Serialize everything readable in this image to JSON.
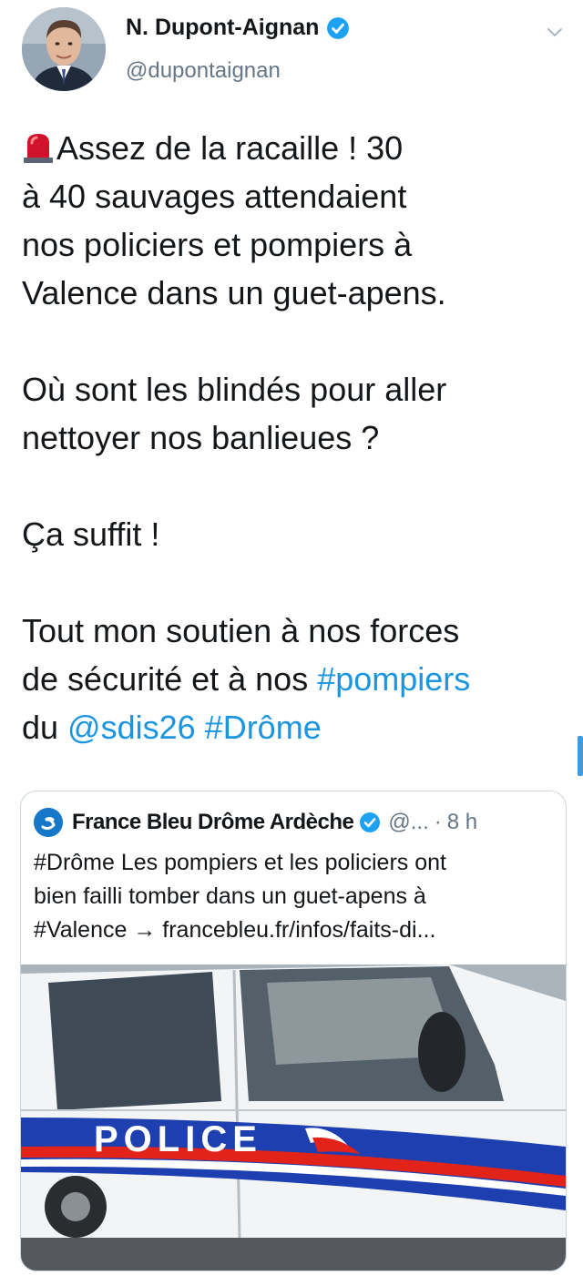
{
  "author": {
    "name": "N. Dupont-Aignan",
    "handle": "@dupontaignan"
  },
  "tweet": {
    "line1": "Assez de la racaille ! 30",
    "line2": "à 40 sauvages attendaient",
    "line3": "nos policiers et pompiers à",
    "line4": "Valence dans un guet-apens.",
    "line5": "Où sont les blindés pour aller",
    "line6": "nettoyer nos banlieues ?",
    "line7": "Ça suffit !",
    "line8": "Tout mon soutien à nos forces",
    "line9_text": "de sécurité et à nos ",
    "line9_hashtag": "#pompiers",
    "line10_text": "du ",
    "line10_mention": "@sdis26",
    "line10_hashtag": "#Drôme"
  },
  "quoted_tweet": {
    "name": "France Bleu Drôme Ardèche",
    "handle": "@...",
    "separator": "·",
    "time": "8 h",
    "line1": "#Drôme Les pompiers et les policiers ont",
    "line2": "bien failli tomber dans un guet-apens à",
    "line3": "#Valence → francebleu.fr/infos/faits-di...",
    "image_text": "POLICE"
  },
  "icons": {
    "verified": "verified-badge-icon",
    "chevron": "chevron-down-icon",
    "siren": "police-siren-emoji"
  },
  "colors": {
    "link": "#1b95e0",
    "verified": "#1da1f2",
    "secondary_text": "#657786",
    "police_blue": "#1d3fb0",
    "police_red": "#e2231a"
  }
}
